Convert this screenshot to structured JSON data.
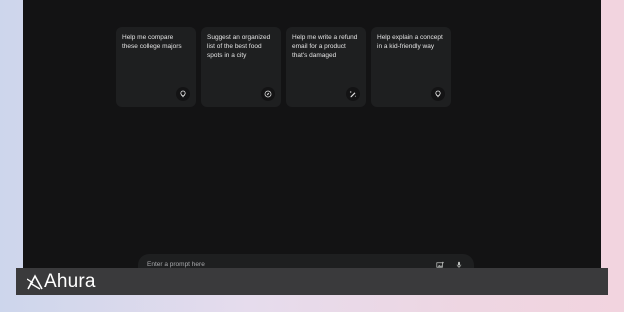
{
  "suggestions": [
    {
      "text": "Help me compare these college majors",
      "icon": "lightbulb-icon"
    },
    {
      "text": "Suggest an organized list of the best food spots in a city",
      "icon": "compass-icon"
    },
    {
      "text": "Help me write a refund email for a product that's damaged",
      "icon": "edit-sparkle-icon"
    },
    {
      "text": "Help explain a concept in a kid-friendly way",
      "icon": "lightbulb-icon"
    }
  ],
  "prompt": {
    "placeholder": "Enter a prompt here",
    "image_button_icon": "add-image-icon",
    "mic_button_icon": "microphone-icon"
  },
  "watermark": {
    "brand": "Ahura"
  },
  "colors": {
    "window_bg": "#131314",
    "card_bg": "#1e1f20",
    "text": "#e3e3e3",
    "placeholder": "#a9aaad",
    "watermark_bar": "#3a3a3c"
  }
}
